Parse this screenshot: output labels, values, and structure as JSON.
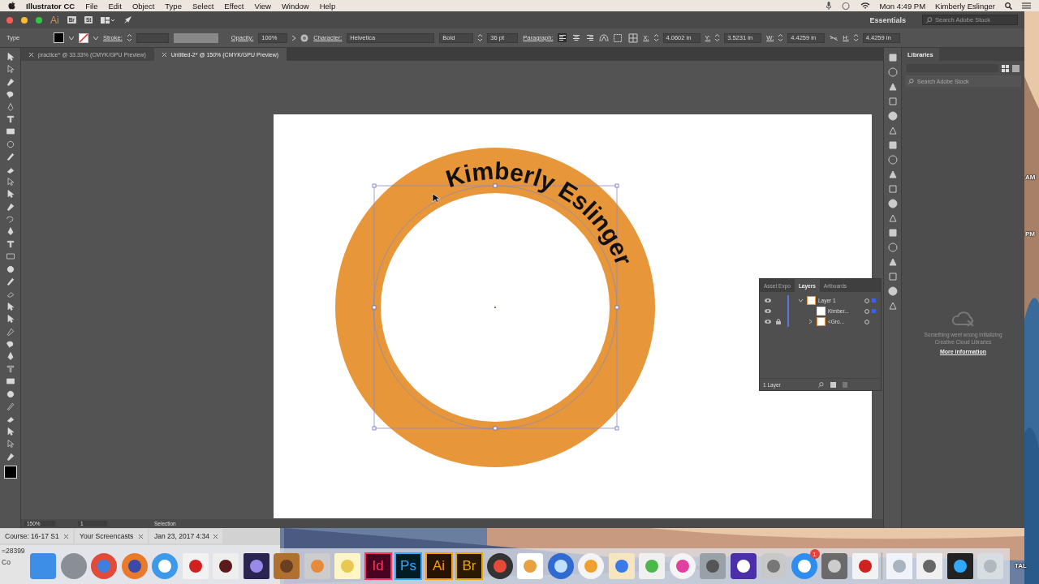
{
  "menubar": {
    "app": "Illustrator CC",
    "menus": [
      "File",
      "Edit",
      "Object",
      "Type",
      "Select",
      "Effect",
      "View",
      "Window",
      "Help"
    ],
    "clock": "Mon 4:49 PM",
    "user": "Kimberly Eslinger"
  },
  "app_bar": {
    "logo": "Ai",
    "bridge": "Br",
    "stock": "St",
    "workspace": "Essentials",
    "search": {
      "placeholder": "Search Adobe Stock"
    }
  },
  "control_bar": {
    "tool": "Type",
    "stroke_label": "Stroke:",
    "opacity_label": "Opacity:",
    "opacity": "100%",
    "character_label": "Character:",
    "font": "Helvetica",
    "style": "Bold",
    "size": "36 pt",
    "paragraph_label": "Paragraph:",
    "align": [
      {
        "selected": true
      },
      {
        "selected": false
      },
      {
        "selected": false
      }
    ],
    "x_label": "X:",
    "x": "4.0602 in",
    "y_label": "Y:",
    "y": "3.5231 in",
    "w_label": "W:",
    "w": "4.4259 in",
    "h_label": "H:",
    "h": "4.4259 in"
  },
  "doc_tabs": [
    {
      "label": "practice* @ 33.33% (CMYK/GPU Preview)",
      "selected": false
    },
    {
      "label": "Untitled-2* @ 150% (CMYK/GPU Preview)",
      "selected": true
    }
  ],
  "artwork": {
    "path_text": "Kimberly Eslinger"
  },
  "layers_panel": {
    "tabs": [
      {
        "label": "Asset Expo",
        "selected": false
      },
      {
        "label": "Layers",
        "selected": true
      },
      {
        "label": "Artboards",
        "selected": false
      }
    ],
    "layers": [
      {
        "name": "Layer 1",
        "kind": "layer",
        "expanded": true,
        "locked": false,
        "selected": true,
        "children": [
          {
            "name": "Kimber...",
            "kind": "text",
            "locked": false,
            "selected": true
          },
          {
            "name": "<Gro...",
            "kind": "group",
            "expanded": false,
            "locked": true,
            "selected": false
          }
        ]
      }
    ],
    "footer": "1 Layer"
  },
  "libraries_panel": {
    "title": "Libraries",
    "search": {
      "placeholder": "Search Adobe Stock"
    },
    "message": "Something went wrong initializing Creative Cloud Libraries",
    "link": "More information"
  },
  "status_bar": {
    "zoom": "150%",
    "artboard": "1",
    "tool": "Selection"
  },
  "browser": {
    "tabs": [
      {
        "label": "Course: 16-17 S1"
      },
      {
        "label": "Your Screencasts"
      },
      {
        "label": "Jan 23, 2017 4:34"
      }
    ],
    "address": "=28399",
    "bookmark": "Co"
  },
  "dock": {
    "labels": [
      "Id",
      "Ps",
      "Ai",
      "Br"
    ],
    "badge": "1"
  },
  "desktop_labels": [
    "AM",
    "PM",
    "TAL"
  ]
}
